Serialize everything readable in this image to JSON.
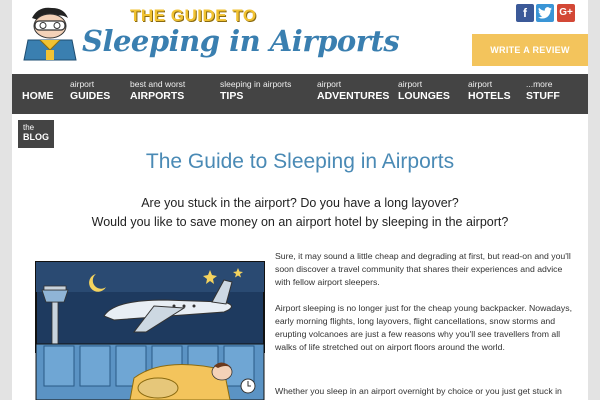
{
  "header": {
    "logo_top": "THE GUIDE TO",
    "logo_main": "Sleeping in Airports",
    "social": [
      {
        "name": "facebook-icon",
        "glyph": "f"
      },
      {
        "name": "twitter-icon",
        "glyph": "t"
      },
      {
        "name": "google-plus-icon",
        "glyph": "G+"
      }
    ],
    "review_button": "WRITE A REVIEW"
  },
  "nav": [
    {
      "small": "",
      "big": "HOME"
    },
    {
      "small": "airport",
      "big": "GUIDES"
    },
    {
      "small": "best and worst",
      "big": "AIRPORTS"
    },
    {
      "small": "sleeping in airports",
      "big": "TIPS"
    },
    {
      "small": "airport",
      "big": "ADVENTURES"
    },
    {
      "small": "airport",
      "big": "LOUNGES"
    },
    {
      "small": "airport",
      "big": "HOTELS"
    },
    {
      "small": "...more",
      "big": "STUFF"
    }
  ],
  "blog_badge": {
    "small": "the",
    "big": "BLOG"
  },
  "main": {
    "title": "The Guide to Sleeping in Airports",
    "intro_line1": "Are you stuck in the airport? Do you have a long layover?",
    "intro_line2": "Would you like to save money on an airport hotel by sleeping in the airport?",
    "p1": "Sure, it may sound a little cheap and degrading at first, but read-on and you'll soon discover a travel community that shares their experiences and advice with fellow airport sleepers.",
    "p2": "Airport sleeping is no longer just for the cheap young backpacker. Nowadays, early morning flights, long layovers, flight cancellations, snow storms and erupting volcanoes are just a few reasons why you'll see travellers from all walks of life stretched out on airport floors around the world.",
    "p3": "Whether you sleep in an airport overnight by choice or you just get stuck in"
  },
  "colors": {
    "nav_bg": "#444444",
    "title_blue": "#4a8ab5",
    "review_yellow": "#f3c45c",
    "logo_blue": "#3a7fb0",
    "logo_yellow": "#f1c232"
  }
}
